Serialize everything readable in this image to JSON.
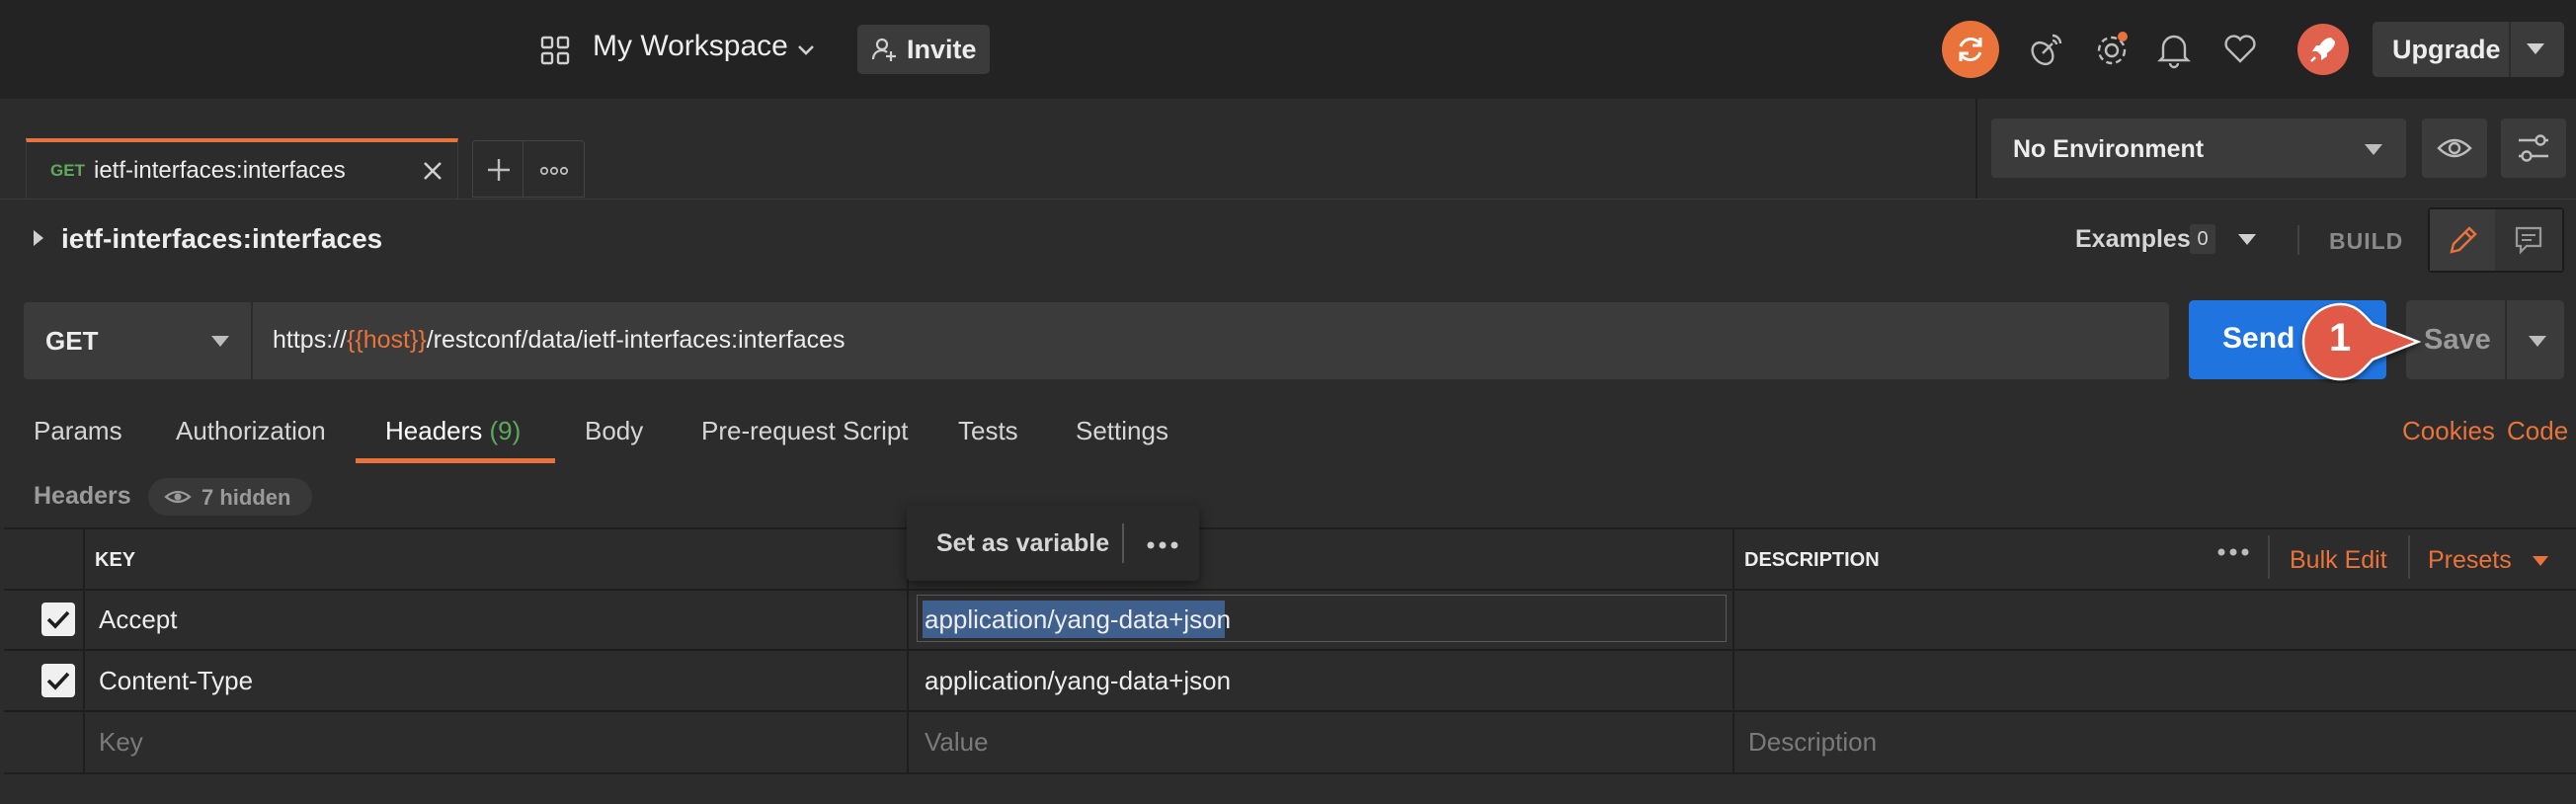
{
  "topbar": {
    "workspace_title": "My Workspace",
    "invite_label": "Invite",
    "upgrade_label": "Upgrade"
  },
  "tabs": {
    "active_tab": {
      "method": "GET",
      "name": "ietf-interfaces:interfaces"
    }
  },
  "environment": {
    "selected": "No Environment"
  },
  "request": {
    "name": "ietf-interfaces:interfaces",
    "examples_label": "Examples",
    "examples_count": "0",
    "build_label": "BUILD",
    "method": "GET",
    "url": {
      "prefix": "https://",
      "variable": "{{host}}",
      "suffix": "/restconf/data/ietf-interfaces:interfaces"
    },
    "send_label": "Send",
    "save_label": "Save",
    "callout_number": "1"
  },
  "subtabs": {
    "params": "Params",
    "authorization": "Authorization",
    "headers": "Headers",
    "headers_count": "(9)",
    "body": "Body",
    "prerequest": "Pre-request Script",
    "tests": "Tests",
    "settings": "Settings",
    "cookies": "Cookies",
    "code": "Code"
  },
  "headers_section": {
    "label": "Headers",
    "hidden_label": "7 hidden",
    "context_menu_label": "Set as variable",
    "bulk_edit_label": "Bulk Edit",
    "presets_label": "Presets",
    "columns": {
      "key": "KEY",
      "description": "DESCRIPTION"
    },
    "rows": [
      {
        "checked": true,
        "key": "Accept",
        "value": "application/yang-data+json",
        "description": ""
      },
      {
        "checked": true,
        "key": "Content-Type",
        "value": "application/yang-data+json",
        "description": ""
      }
    ],
    "placeholders": {
      "key": "Key",
      "value": "Value",
      "description": "Description"
    }
  },
  "colors": {
    "accent": "#e9733a",
    "send_blue": "#1f74e0",
    "method_green": "#5ea95d",
    "background": "#2c2c2c",
    "topbar": "#232323",
    "callout_red": "#e05a47"
  }
}
